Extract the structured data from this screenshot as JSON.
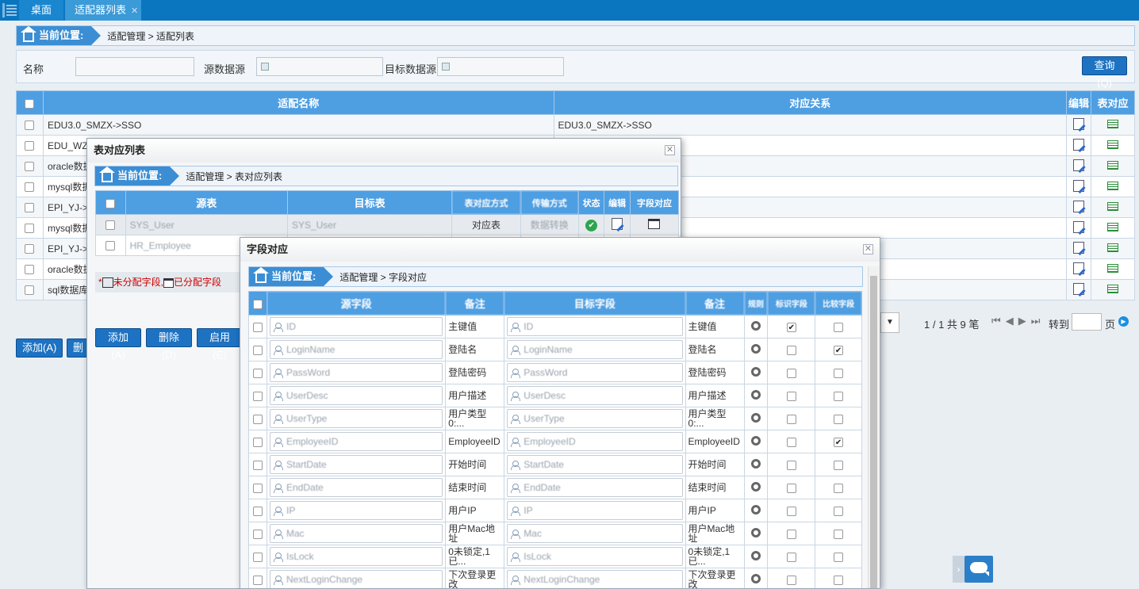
{
  "tabs": {
    "desk": "桌面",
    "active": "适配器列表"
  },
  "main": {
    "bread_label": "当前位置:",
    "bread_path": "适配管理 > 适配列表",
    "search": {
      "name_label": "名称",
      "src_label": "源数据源",
      "tgt_label": "目标数据源",
      "query": "查询(Q)"
    },
    "headers": {
      "name": "适配名称",
      "rel": "对应关系",
      "edit": "编辑",
      "tblmap": "表对应"
    },
    "rows": [
      {
        "name": "EDU3.0_SMZX->SSO",
        "rel": "EDU3.0_SMZX->SSO"
      },
      {
        "name": "EDU_WZ",
        "rel": ""
      },
      {
        "name": "oracle数据",
        "rel": ""
      },
      {
        "name": "mysql数据",
        "rel": ""
      },
      {
        "name": "EPI_YJ->",
        "rel": ""
      },
      {
        "name": "mysql数据",
        "rel": ""
      },
      {
        "name": "EPI_YJ->",
        "rel": ""
      },
      {
        "name": "oracle数据",
        "rel": ""
      },
      {
        "name": "sql数据库",
        "rel": ""
      }
    ],
    "add": "添加(A)",
    "del": "删除",
    "pager": {
      "info": "1 / 1 共 9 笔",
      "goto": "转到",
      "page": "页"
    }
  },
  "dlg1": {
    "title": "表对应列表",
    "bread_label": "当前位置:",
    "bread_path": "适配管理 > 表对应列表",
    "headers": {
      "src": "源表",
      "tgt": "目标表",
      "m": "表对应方式",
      "t": "传输方式",
      "s": "状态",
      "e": "编辑",
      "f": "字段对应"
    },
    "rows": [
      {
        "src": "SYS_User",
        "tgt": "SYS_User",
        "m": "对应表",
        "t": "数据转换"
      },
      {
        "src": "HR_Employee",
        "tgt": "",
        "m": "",
        "t": ""
      }
    ],
    "legend_unassigned": "未分配字段,",
    "legend_assigned": "已分配字段",
    "add": "添加(A)",
    "del": "删除(D)",
    "enable": "启用(E)"
  },
  "dlg2": {
    "title": "字段对应",
    "bread_label": "当前位置:",
    "bread_path": "适配管理 > 字段对应",
    "headers": {
      "src": "源字段",
      "note1": "备注",
      "tgt": "目标字段",
      "note2": "备注",
      "rule": "规则",
      "key": "标识字段",
      "cmp": "比较字段"
    },
    "rows": [
      {
        "src": "ID",
        "note1": "主键值",
        "tgt": "ID",
        "note2": "主键值",
        "key": true,
        "cmp": false
      },
      {
        "src": "LoginName",
        "note1": "登陆名",
        "tgt": "LoginName",
        "note2": "登陆名",
        "key": false,
        "cmp": true
      },
      {
        "src": "PassWord",
        "note1": "登陆密码",
        "tgt": "PassWord",
        "note2": "登陆密码",
        "key": false,
        "cmp": false
      },
      {
        "src": "UserDesc",
        "note1": "用户描述",
        "tgt": "UserDesc",
        "note2": "用户描述",
        "key": false,
        "cmp": false
      },
      {
        "src": "UserType",
        "note1": "用户类型 0:...",
        "tgt": "UserType",
        "note2": "用户类型 0:...",
        "key": false,
        "cmp": false
      },
      {
        "src": "EmployeeID",
        "note1": "EmployeeID",
        "tgt": "EmployeeID",
        "note2": "EmployeeID",
        "key": false,
        "cmp": true
      },
      {
        "src": "StartDate",
        "note1": "开始时间",
        "tgt": "StartDate",
        "note2": "开始时间",
        "key": false,
        "cmp": false
      },
      {
        "src": "EndDate",
        "note1": "结束时间",
        "tgt": "EndDate",
        "note2": "结束时间",
        "key": false,
        "cmp": false
      },
      {
        "src": "IP",
        "note1": "用户IP",
        "tgt": "IP",
        "note2": "用户IP",
        "key": false,
        "cmp": false
      },
      {
        "src": "Mac",
        "note1": "用户Mac地址",
        "tgt": "Mac",
        "note2": "用户Mac地址",
        "key": false,
        "cmp": false
      },
      {
        "src": "IsLock",
        "note1": "0未锁定,1已...",
        "tgt": "IsLock",
        "note2": "0未锁定,1已...",
        "key": false,
        "cmp": false
      },
      {
        "src": "NextLoginChange",
        "note1": "下次登录更改",
        "tgt": "NextLoginChange",
        "note2": "下次登录更改",
        "key": false,
        "cmp": false
      }
    ]
  }
}
